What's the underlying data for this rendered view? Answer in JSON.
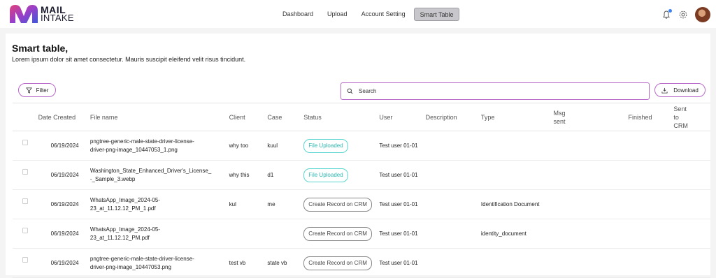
{
  "brand": {
    "line1": "MAIL",
    "line2": "INTAKE"
  },
  "nav": [
    {
      "label": "Dashboard"
    },
    {
      "label": "Upload"
    },
    {
      "label": "Account Setting"
    },
    {
      "label": "Smart Table",
      "active": true
    }
  ],
  "page": {
    "title": "Smart table,",
    "subtitle": "Lorem ipsum dolor sit amet consectetur. Mauris suscipit eleifend velit risus tincidunt."
  },
  "toolbar": {
    "filter_label": "Filter",
    "search_placeholder": "Search",
    "download_label": "Download"
  },
  "table": {
    "headers": [
      "Date Created",
      "File name",
      "Client",
      "Case",
      "Status",
      "User",
      "Description",
      "Type",
      "Msg sent",
      "Finished",
      "Sent to CRM"
    ],
    "rows": [
      {
        "date": "06/19/2024",
        "file1": "pngtree-generic-male-state-driver-license-",
        "file2": "driver-png-image_10447053_1.png",
        "client": "why too",
        "case": "kuul",
        "status": "File Uploaded",
        "status_kind": "uploaded",
        "user": "Test user 01-01",
        "description": "",
        "type": ""
      },
      {
        "date": "06/19/2024",
        "file1": "Washington_State_Enhanced_Driver's_License_",
        "file2": "-_Sample_3.webp",
        "client": "why this",
        "case": "d1",
        "status": "File Uploaded",
        "status_kind": "uploaded",
        "user": "Test user 01-01",
        "description": "",
        "type": ""
      },
      {
        "date": "06/19/2024",
        "file1": "WhatsApp_Image_2024-05-",
        "file2": "23_at_11.12.12_PM_1.pdf",
        "client": "kul",
        "case": "me",
        "status": "Create Record on CRM",
        "status_kind": "crm",
        "user": "Test user 01-01",
        "description": "",
        "type": "Identification Document"
      },
      {
        "date": "06/19/2024",
        "file1": "WhatsApp_Image_2024-05-",
        "file2": "23_at_11.12.12_PM.pdf",
        "client": "",
        "case": "",
        "status": "Create Record on CRM",
        "status_kind": "crm",
        "user": "Test user 01-01",
        "description": "",
        "type": "identity_document"
      },
      {
        "date": "06/19/2024",
        "file1": "pngtree-generic-male-state-driver-license-",
        "file2": "driver-png-image_10447053.png",
        "client": "test vb",
        "case": "state vb",
        "status": "Create Record on CRM",
        "status_kind": "crm",
        "user": "Test user 01-01",
        "description": "",
        "type": ""
      }
    ]
  },
  "colors": {
    "accent": "#b868c8",
    "uploaded": "#2cb4ae",
    "notification_dot": "#3b82f6"
  },
  "icons": [
    "bell-icon",
    "gear-icon",
    "filter-icon",
    "search-icon",
    "download-icon"
  ]
}
